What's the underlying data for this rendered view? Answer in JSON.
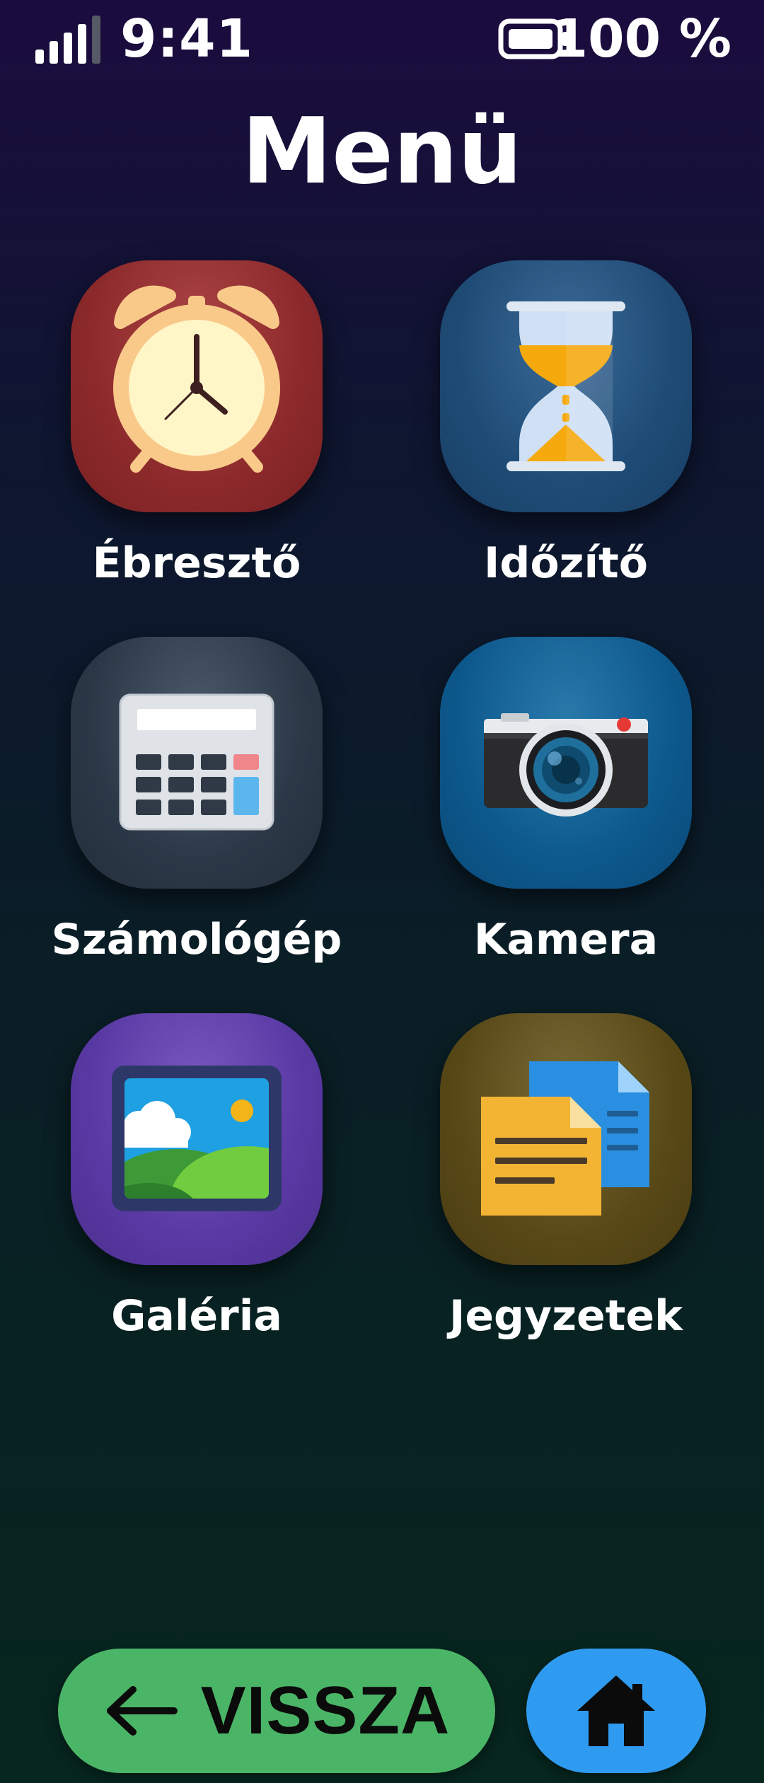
{
  "status_bar": {
    "time": "9:41",
    "battery_text": "100 %",
    "signal_bars": 4,
    "signal_icon": "signal-strength-icon",
    "battery_icon": "battery-full-icon"
  },
  "title": "Menü",
  "apps": [
    {
      "label": "Ébresztő",
      "icon": "alarm-clock-icon",
      "color": "#8e2a2c"
    },
    {
      "label": "Időzítő",
      "icon": "hourglass-icon",
      "color": "#1f4d78"
    },
    {
      "label": "Számológép",
      "icon": "calculator-icon",
      "color": "#2c3948"
    },
    {
      "label": "Kamera",
      "icon": "camera-icon",
      "color": "#0d5a8f"
    },
    {
      "label": "Galéria",
      "icon": "gallery-picture-icon",
      "color": "#5b3aa6"
    },
    {
      "label": "Jegyzetek",
      "icon": "notes-documents-icon",
      "color": "#5a4a18"
    }
  ],
  "nav": {
    "back_label": "VISSZA",
    "back_icon": "arrow-left-icon",
    "back_color": "#4bb567",
    "home_icon": "home-icon",
    "home_color": "#2f9bf0"
  }
}
